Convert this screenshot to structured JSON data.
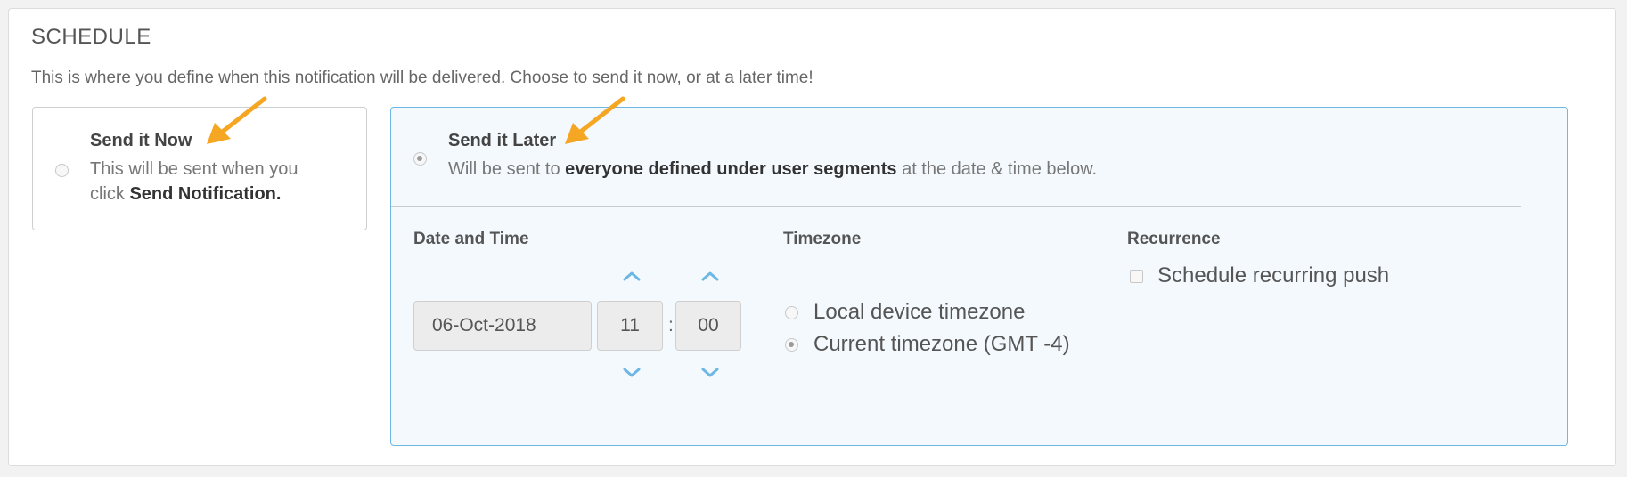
{
  "schedule": {
    "title": "SCHEDULE",
    "description": "This is where you define when this notification will be delivered. Choose to send it now, or at a later time!"
  },
  "send_now": {
    "title": "Send it Now",
    "text_line1": "This will be sent when you",
    "text_prefix": "click ",
    "text_bold": "Send Notification.",
    "selected": false
  },
  "send_later": {
    "title": "Send it Later",
    "text_prefix": "Will be sent to ",
    "text_bold": "everyone defined under user segments",
    "text_suffix": " at the date & time below.",
    "selected": true
  },
  "datetime": {
    "label": "Date and Time",
    "date": "06-Oct-2018",
    "hour": "11",
    "separator": ":",
    "minute": "00"
  },
  "timezone": {
    "label": "Timezone",
    "options": [
      {
        "label": "Local device timezone",
        "selected": false
      },
      {
        "label": "Current timezone (GMT -4)",
        "selected": true
      }
    ]
  },
  "recurrence": {
    "label": "Recurrence",
    "checkbox_label": "Schedule recurring push",
    "checked": false
  },
  "colors": {
    "accent": "#6eb7e4",
    "annotation_arrow": "#f5a623",
    "selected_card_bg": "#f3f9fd"
  }
}
